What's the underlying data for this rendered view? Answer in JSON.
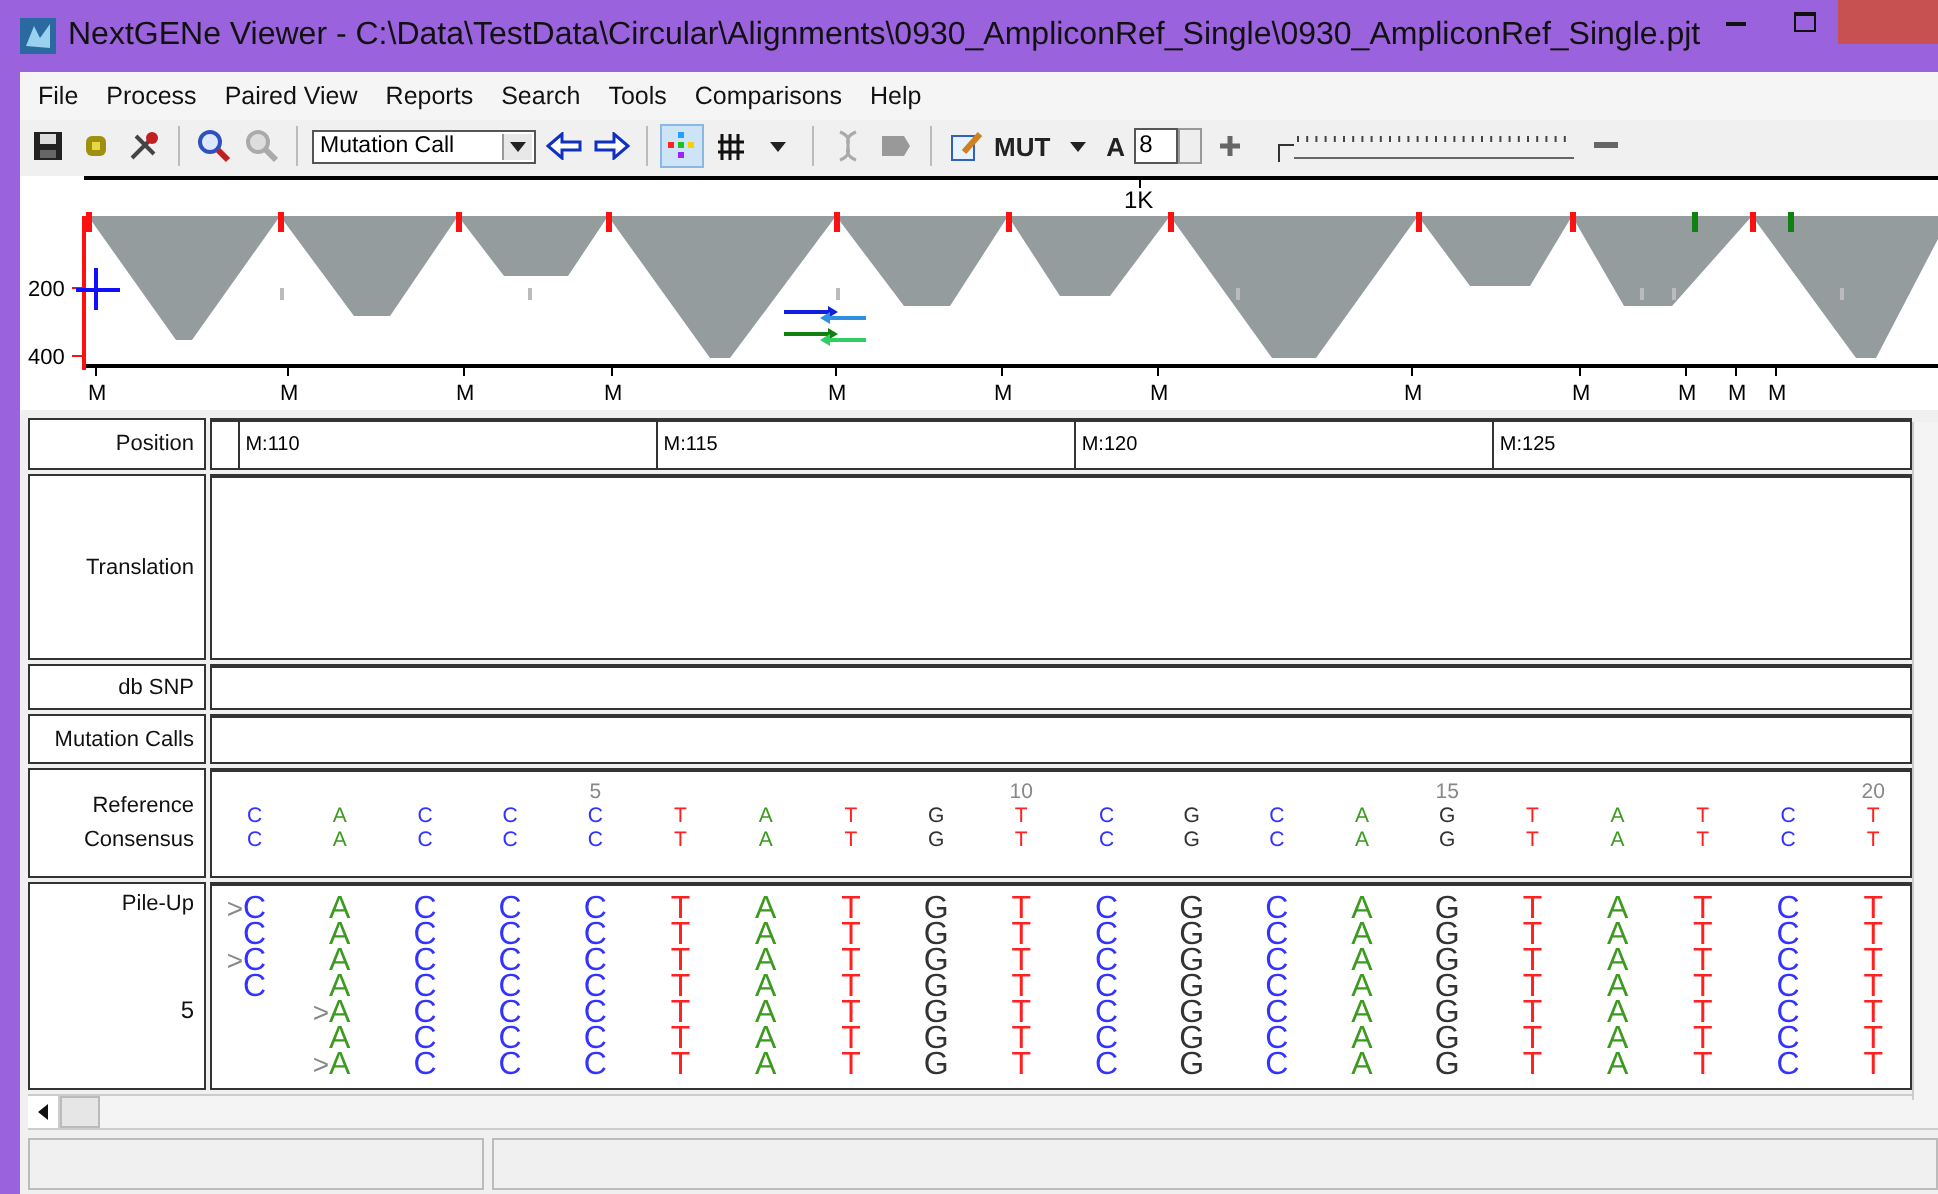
{
  "window": {
    "title": "NextGENe Viewer - C:\\Data\\TestData\\Circular\\Alignments\\0930_AmpliconRef_Single\\0930_AmpliconRef_Single.pjt"
  },
  "menu": [
    "File",
    "Process",
    "Paired View",
    "Reports",
    "Search",
    "Tools",
    "Comparisons",
    "Help"
  ],
  "toolbar": {
    "mode": "Mutation Call",
    "mut_label": "MUT",
    "font_label": "A",
    "font_size": "8",
    "zoom": {
      "level": 0
    },
    "color_view_selected": true
  },
  "overview": {
    "scale_label": "1K",
    "y_labels": [
      "200",
      "400"
    ],
    "markers": [
      "M",
      "M",
      "M",
      "M",
      "M",
      "M",
      "M",
      "M",
      "M",
      "M",
      "M",
      "M"
    ]
  },
  "tracks": {
    "labels": {
      "position": "Position",
      "translation": "Translation",
      "dbsnp": "db SNP",
      "mutation_calls": "Mutation Calls",
      "reference": "Reference",
      "consensus": "Consensus",
      "pileup": "Pile-Up",
      "depth": "5"
    },
    "positions": [
      "M:110",
      "M:115",
      "M:120",
      "M:125"
    ],
    "bases": [
      {
        "ref": "C",
        "cons": "C",
        "color": "#3333ff",
        "reads": [
          {
            "mark": ">",
            "base": "C"
          },
          {
            "base": "C"
          },
          {
            "mark": ">",
            "base": "C"
          },
          {
            "base": "C"
          }
        ]
      },
      {
        "ref": "A",
        "cons": "A",
        "color": "#3c9a1e",
        "reads": [
          {
            "base": "A"
          },
          {
            "base": "A"
          },
          {
            "base": "A"
          },
          {
            "base": "A"
          },
          {
            "mark": ">",
            "base": "A"
          },
          {
            "base": "A"
          },
          {
            "mark": ">",
            "base": "A"
          }
        ]
      },
      {
        "ref": "C",
        "cons": "C",
        "color": "#3333ff",
        "reads": [
          {
            "base": "C"
          },
          {
            "base": "C"
          },
          {
            "base": "C"
          },
          {
            "base": "C"
          },
          {
            "base": "C"
          },
          {
            "base": "C"
          },
          {
            "base": "C"
          }
        ]
      },
      {
        "ref": "C",
        "cons": "C",
        "color": "#3333ff",
        "reads": [
          {
            "base": "C"
          },
          {
            "base": "C"
          },
          {
            "base": "C"
          },
          {
            "base": "C"
          },
          {
            "base": "C"
          },
          {
            "base": "C"
          },
          {
            "base": "C"
          }
        ]
      },
      {
        "tick": "5",
        "ref": "C",
        "cons": "C",
        "color": "#3333ff",
        "reads": [
          {
            "base": "C"
          },
          {
            "base": "C"
          },
          {
            "base": "C"
          },
          {
            "base": "C"
          },
          {
            "base": "C"
          },
          {
            "base": "C"
          },
          {
            "base": "C"
          }
        ]
      },
      {
        "ref": "T",
        "cons": "T",
        "color": "#ff2020",
        "reads": [
          {
            "base": "T"
          },
          {
            "base": "T"
          },
          {
            "base": "T"
          },
          {
            "base": "T"
          },
          {
            "base": "T"
          },
          {
            "base": "T"
          },
          {
            "base": "T"
          }
        ]
      },
      {
        "ref": "A",
        "cons": "A",
        "color": "#3c9a1e",
        "reads": [
          {
            "base": "A"
          },
          {
            "base": "A"
          },
          {
            "base": "A"
          },
          {
            "base": "A"
          },
          {
            "base": "A"
          },
          {
            "base": "A"
          },
          {
            "base": "A"
          }
        ]
      },
      {
        "ref": "T",
        "cons": "T",
        "color": "#ff2020",
        "reads": [
          {
            "base": "T"
          },
          {
            "base": "T"
          },
          {
            "base": "T"
          },
          {
            "base": "T"
          },
          {
            "base": "T"
          },
          {
            "base": "T"
          },
          {
            "base": "T"
          }
        ]
      },
      {
        "ref": "G",
        "cons": "G",
        "color": "#333333",
        "reads": [
          {
            "base": "G"
          },
          {
            "base": "G"
          },
          {
            "base": "G"
          },
          {
            "base": "G"
          },
          {
            "base": "G"
          },
          {
            "base": "G"
          },
          {
            "base": "G"
          }
        ]
      },
      {
        "tick": "10",
        "ref": "T",
        "cons": "T",
        "color": "#ff2020",
        "reads": [
          {
            "base": "T"
          },
          {
            "base": "T"
          },
          {
            "base": "T"
          },
          {
            "base": "T"
          },
          {
            "base": "T"
          },
          {
            "base": "T"
          },
          {
            "base": "T"
          }
        ]
      },
      {
        "ref": "C",
        "cons": "C",
        "color": "#3333ff",
        "reads": [
          {
            "base": "C"
          },
          {
            "base": "C"
          },
          {
            "base": "C"
          },
          {
            "base": "C"
          },
          {
            "base": "C"
          },
          {
            "base": "C"
          },
          {
            "base": "C"
          }
        ]
      },
      {
        "ref": "G",
        "cons": "G",
        "color": "#333333",
        "reads": [
          {
            "base": "G"
          },
          {
            "base": "G"
          },
          {
            "base": "G"
          },
          {
            "base": "G"
          },
          {
            "base": "G"
          },
          {
            "base": "G"
          },
          {
            "base": "G"
          }
        ]
      },
      {
        "ref": "C",
        "cons": "C",
        "color": "#3333ff",
        "reads": [
          {
            "base": "C"
          },
          {
            "base": "C"
          },
          {
            "base": "C"
          },
          {
            "base": "C"
          },
          {
            "base": "C"
          },
          {
            "base": "C"
          },
          {
            "base": "C"
          }
        ]
      },
      {
        "ref": "A",
        "cons": "A",
        "color": "#3c9a1e",
        "reads": [
          {
            "base": "A"
          },
          {
            "base": "A"
          },
          {
            "base": "A"
          },
          {
            "base": "A"
          },
          {
            "base": "A"
          },
          {
            "base": "A"
          },
          {
            "base": "A"
          }
        ]
      },
      {
        "tick": "15",
        "ref": "G",
        "cons": "G",
        "color": "#333333",
        "reads": [
          {
            "base": "G"
          },
          {
            "base": "G"
          },
          {
            "base": "G"
          },
          {
            "base": "G"
          },
          {
            "base": "G"
          },
          {
            "base": "G"
          },
          {
            "base": "G"
          }
        ]
      },
      {
        "ref": "T",
        "cons": "T",
        "color": "#ff2020",
        "reads": [
          {
            "base": "T"
          },
          {
            "base": "T"
          },
          {
            "base": "T"
          },
          {
            "base": "T"
          },
          {
            "base": "T"
          },
          {
            "base": "T"
          },
          {
            "base": "T"
          }
        ]
      },
      {
        "ref": "A",
        "cons": "A",
        "color": "#3c9a1e",
        "reads": [
          {
            "base": "A"
          },
          {
            "base": "A"
          },
          {
            "base": "A"
          },
          {
            "base": "A"
          },
          {
            "base": "A"
          },
          {
            "base": "A"
          },
          {
            "base": "A"
          }
        ]
      },
      {
        "ref": "T",
        "cons": "T",
        "color": "#ff2020",
        "reads": [
          {
            "base": "T"
          },
          {
            "base": "T"
          },
          {
            "base": "T"
          },
          {
            "base": "T"
          },
          {
            "base": "T"
          },
          {
            "base": "T"
          },
          {
            "base": "T"
          }
        ]
      },
      {
        "ref": "C",
        "cons": "C",
        "color": "#3333ff",
        "reads": [
          {
            "base": "C"
          },
          {
            "base": "C"
          },
          {
            "base": "C"
          },
          {
            "base": "C"
          },
          {
            "base": "C"
          },
          {
            "base": "C"
          },
          {
            "base": "C"
          }
        ]
      },
      {
        "tick": "20",
        "ref": "T",
        "cons": "T",
        "color": "#ff2020",
        "reads": [
          {
            "base": "T"
          },
          {
            "base": "T"
          },
          {
            "base": "T"
          },
          {
            "base": "T"
          },
          {
            "base": "T"
          },
          {
            "base": "T"
          },
          {
            "base": "T"
          }
        ]
      }
    ]
  }
}
